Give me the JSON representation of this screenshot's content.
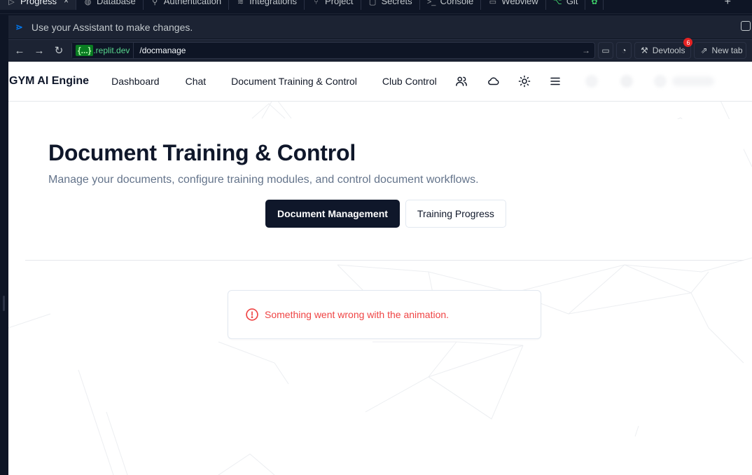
{
  "ide": {
    "tabs": [
      {
        "label": "Progress",
        "icon": "progress-icon",
        "active": true
      },
      {
        "label": "Database",
        "icon": "database-icon"
      },
      {
        "label": "Authentication",
        "icon": "user-icon"
      },
      {
        "label": "Integrations",
        "icon": "layers-icon"
      },
      {
        "label": "Project",
        "icon": "branch-icon"
      },
      {
        "label": "Secrets",
        "icon": "lock-icon"
      },
      {
        "label": "Console",
        "icon": "terminal-icon"
      },
      {
        "label": "Webview",
        "icon": "monitor-icon"
      },
      {
        "label": "Git",
        "icon": "git-icon"
      }
    ],
    "close_glyph": "×",
    "add_tab_glyph": "+",
    "assistant_prompt": "Use your Assistant to make changes.",
    "url": {
      "domain_curly": "{...}",
      "domain_suffix": ".replit.dev",
      "path": "/docmanage"
    },
    "devtools_label": "Devtools",
    "devtools_badge": "6",
    "new_tab_label": "New tab"
  },
  "app": {
    "brand": "GYM AI Engine",
    "nav": {
      "dashboard": "Dashboard",
      "chat": "Chat",
      "doc_training": "Document Training & Control",
      "club_control": "Club Control"
    },
    "hero": {
      "title": "Document Training & Control",
      "subtitle": "Manage your documents, configure training modules, and control document workflows.",
      "tab_active": "Document Management",
      "tab_inactive": "Training Progress"
    },
    "error_message": "Something went wrong with the animation."
  },
  "colors": {
    "ide_bg": "#0e1525",
    "ide_panel": "#1c2333",
    "primary_dark": "#0f172a",
    "error_red": "#ef4444",
    "badge_red": "#e52222",
    "replit_green": "#58d68d"
  }
}
